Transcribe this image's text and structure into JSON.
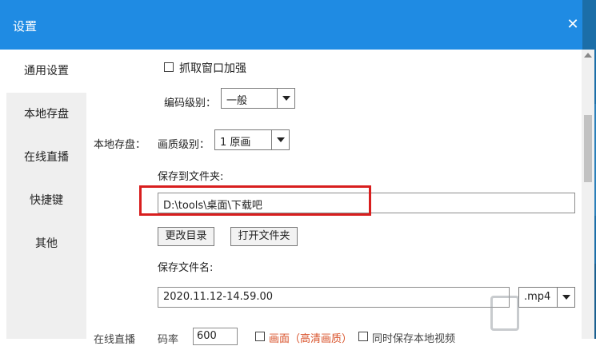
{
  "window": {
    "title": "设置"
  },
  "sidebar": {
    "items": [
      {
        "label": "通用设置"
      },
      {
        "label": "本地存盘"
      },
      {
        "label": "在线直播"
      },
      {
        "label": "快捷键"
      },
      {
        "label": "其他"
      }
    ]
  },
  "capture": {
    "enhance_label": "抓取窗口加强"
  },
  "encoding": {
    "label": "编码级别：",
    "value": "一般"
  },
  "local_save": {
    "section_label": "本地存盘：",
    "quality_label": "画质级别：",
    "quality_value": "1 原画",
    "folder_label": "保存到文件夹:",
    "folder_value": "D:\\tools\\桌面\\下载吧",
    "change_dir_label": "更改目录",
    "open_folder_label": "打开文件夹",
    "filename_label": "保存文件名:",
    "filename_value": "2020.11.12-14.59.00",
    "ext_value": ".mp4"
  },
  "live_partial": {
    "section_label": "在线直播",
    "field_label": "码率",
    "field_value": "600",
    "check1_label": "画面（高清画质）",
    "check2_label": "同时保存本地视频"
  },
  "colors": {
    "titlebar": "#1f8be3",
    "highlight": "#d81e1e"
  }
}
